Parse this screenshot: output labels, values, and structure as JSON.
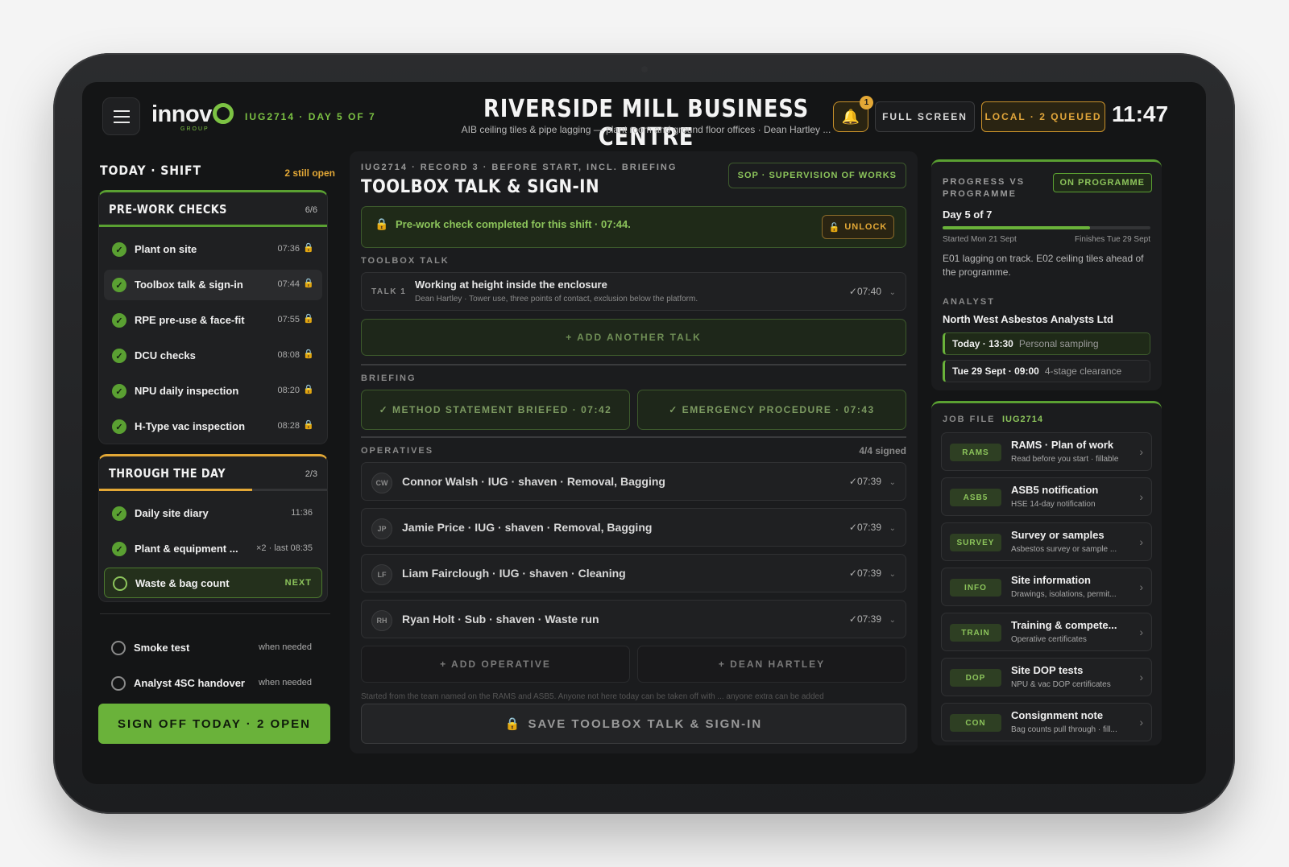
{
  "topbar": {
    "logo_text": "innov",
    "logo_sub": "GROUP",
    "job_tag": "IUG2714 · DAY 5 OF 7",
    "site_title": "RIVERSIDE MILL BUSINESS CENTRE",
    "site_subtitle": "AIB ceiling tiles & pipe lagging — plant room and ground floor offices · Dean Hartley ...",
    "notification_count": "1",
    "full_screen_label": "FULL SCREEN",
    "queue_label": "LOCAL · 2 QUEUED",
    "clock": "11:47"
  },
  "left": {
    "heading": "TODAY · SHIFT",
    "open_count": "2 still open",
    "prework": {
      "title": "PRE-WORK CHECKS",
      "count": "6/6",
      "items": [
        {
          "label": "Plant on site",
          "time": "07:36"
        },
        {
          "label": "Toolbox talk & sign-in",
          "time": "07:44"
        },
        {
          "label": "RPE pre-use & face-fit",
          "time": "07:55"
        },
        {
          "label": "DCU checks",
          "time": "08:08"
        },
        {
          "label": "NPU daily inspection",
          "time": "08:20"
        },
        {
          "label": "H-Type vac inspection",
          "time": "08:28"
        }
      ]
    },
    "through_day": {
      "title": "THROUGH THE DAY",
      "count": "2/3",
      "progress": 0.67,
      "items": [
        {
          "label": "Daily site diary",
          "time": "11:36"
        },
        {
          "label": "Plant & equipment ...",
          "time": "×2 · last 08:35"
        },
        {
          "label": "Waste & bag count",
          "time": "NEXT"
        }
      ]
    },
    "as_needed": [
      {
        "label": "Smoke test",
        "note": "when needed"
      },
      {
        "label": "Analyst 4SC handover",
        "note": "when needed"
      }
    ],
    "signoff_label": "SIGN OFF TODAY · 2 OPEN"
  },
  "main": {
    "breadcrumb": "IUG2714 · RECORD 3 · BEFORE START, INCL. BRIEFING",
    "title": "TOOLBOX TALK & SIGN-IN",
    "sop_label": "SOP · SUPERVISION OF WORKS",
    "notice": "Pre-work check completed for this shift · 07:44.",
    "unlock_label": "UNLOCK",
    "toolbox_label": "TOOLBOX TALK",
    "talk": {
      "number": "TALK 1",
      "title": "Working at height inside the enclosure",
      "sub": "Dean Hartley · Tower use, three points of contact, exclusion below the platform.",
      "time": "✓07:40"
    },
    "add_talk_label": "+ ADD ANOTHER TALK",
    "briefing_label": "BRIEFING",
    "briefing": [
      "✓ METHOD STATEMENT BRIEFED · 07:42",
      "✓ EMERGENCY PROCEDURE · 07:43"
    ],
    "operatives_label": "OPERATIVES",
    "operatives_count": "4/4 signed",
    "operatives": [
      {
        "initials": "CW",
        "label": "Connor Walsh · IUG · shaven · Removal, Bagging",
        "time": "✓07:39"
      },
      {
        "initials": "JP",
        "label": "Jamie Price · IUG · shaven · Removal, Bagging",
        "time": "✓07:39"
      },
      {
        "initials": "LF",
        "label": "Liam Fairclough · IUG · shaven · Cleaning",
        "time": "✓07:39"
      },
      {
        "initials": "RH",
        "label": "Ryan Holt · Sub · shaven · Waste run",
        "time": "✓07:39"
      }
    ],
    "add_operative_label": "+ ADD OPERATIVE",
    "add_supervisor_label": "+ DEAN HARTLEY",
    "footnote": "Started from the team named on the RAMS and ASB5. Anyone not here today can be taken off with ... anyone extra can be added",
    "save_label": "SAVE TOOLBOX TALK & SIGN-IN"
  },
  "progress": {
    "label": "PROGRESS VS PROGRAMME",
    "status": "ON PROGRAMME",
    "day": "Day 5 of 7",
    "fraction": 0.71,
    "started": "Started Mon 21 Sept",
    "finishes": "Finishes Tue 29 Sept",
    "note": "E01 lagging on track. E02 ceiling tiles ahead of the programme.",
    "analyst_label": "ANALYST",
    "analyst_name": "North West Asbestos Analysts Ltd",
    "visits": [
      {
        "when": "Today · 13:30",
        "what": "Personal sampling"
      },
      {
        "when": "Tue 29 Sept · 09:00",
        "what": "4-stage clearance"
      }
    ]
  },
  "job_file": {
    "label": "JOB FILE",
    "id": "IUG2714",
    "docs": [
      {
        "tag": "RAMS",
        "title": "RAMS · Plan of work",
        "sub": "Read before you start · fillable"
      },
      {
        "tag": "ASB5",
        "title": "ASB5 notification",
        "sub": "HSE 14-day notification"
      },
      {
        "tag": "SURVEY",
        "title": "Survey or samples",
        "sub": "Asbestos survey or sample ..."
      },
      {
        "tag": "INFO",
        "title": "Site information",
        "sub": "Drawings, isolations, permit..."
      },
      {
        "tag": "TRAIN",
        "title": "Training & compete...",
        "sub": "Operative certificates"
      },
      {
        "tag": "DOP",
        "title": "Site DOP tests",
        "sub": "NPU & vac DOP certificates"
      },
      {
        "tag": "CON",
        "title": "Consignment note",
        "sub": "Bag counts pull through · fill..."
      }
    ]
  },
  "colors": {
    "accent": "#6ab23a",
    "warning": "#e3a836",
    "background": "#141516"
  }
}
